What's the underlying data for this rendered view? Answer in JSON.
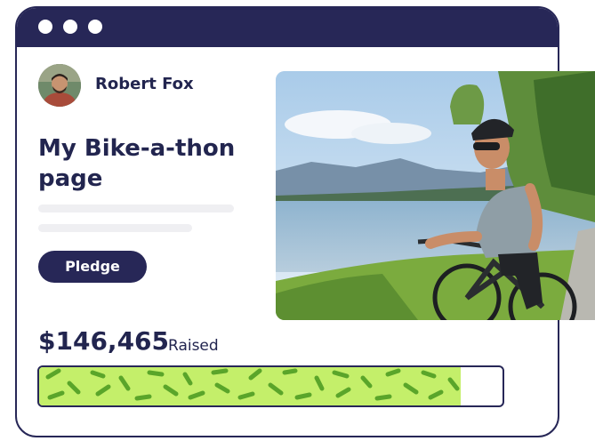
{
  "window": {
    "titlebar_dots": [
      "window-dot",
      "window-dot",
      "window-dot"
    ]
  },
  "profile": {
    "name": "Robert Fox"
  },
  "page": {
    "title": "My Bike-a-thon page"
  },
  "actions": {
    "pledge_label": "Pledge"
  },
  "fundraising": {
    "amount": "$146,465",
    "raised_label": "Raised",
    "progress_fraction": 0.91
  },
  "colors": {
    "navy": "#272757",
    "progress_green": "#c4ef6a",
    "progress_dash": "#5aa52a"
  }
}
